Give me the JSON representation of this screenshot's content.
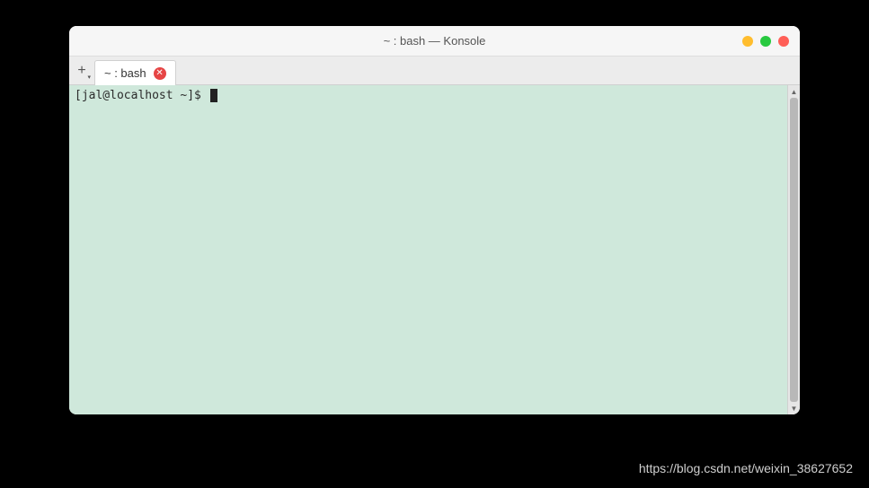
{
  "window": {
    "title": "~ : bash — Konsole"
  },
  "tabs": {
    "active_label": "~ : bash"
  },
  "terminal": {
    "prompt": "[jal@localhost ~]$"
  },
  "watermark": {
    "text": "https://blog.csdn.net/weixin_38627652"
  }
}
